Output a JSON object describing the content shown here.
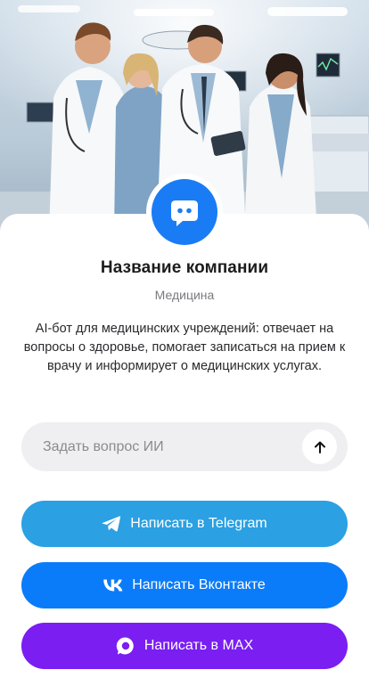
{
  "company": {
    "name": "Название компании",
    "category": "Медицина",
    "description": "AI-бот для медицинских учреждений: отвечает на вопросы о здоровье, помогает записаться на прием к врачу и информирует о медицинских услугах.",
    "avatar_icon": "chat-bot-icon"
  },
  "ask": {
    "placeholder": "Задать вопрос ИИ",
    "send_icon": "arrow-up-icon"
  },
  "buttons": {
    "telegram": {
      "label": "Написать в Telegram",
      "icon": "telegram-icon",
      "color": "#2ba0e2"
    },
    "vk": {
      "label": "Написать Вконтакте",
      "icon": "vk-icon",
      "color": "#0b7cf9"
    },
    "max": {
      "label": "Написать в MAX",
      "icon": "max-icon",
      "color": "#7a1ef2"
    }
  },
  "colors": {
    "accent": "#1a7cf5"
  }
}
